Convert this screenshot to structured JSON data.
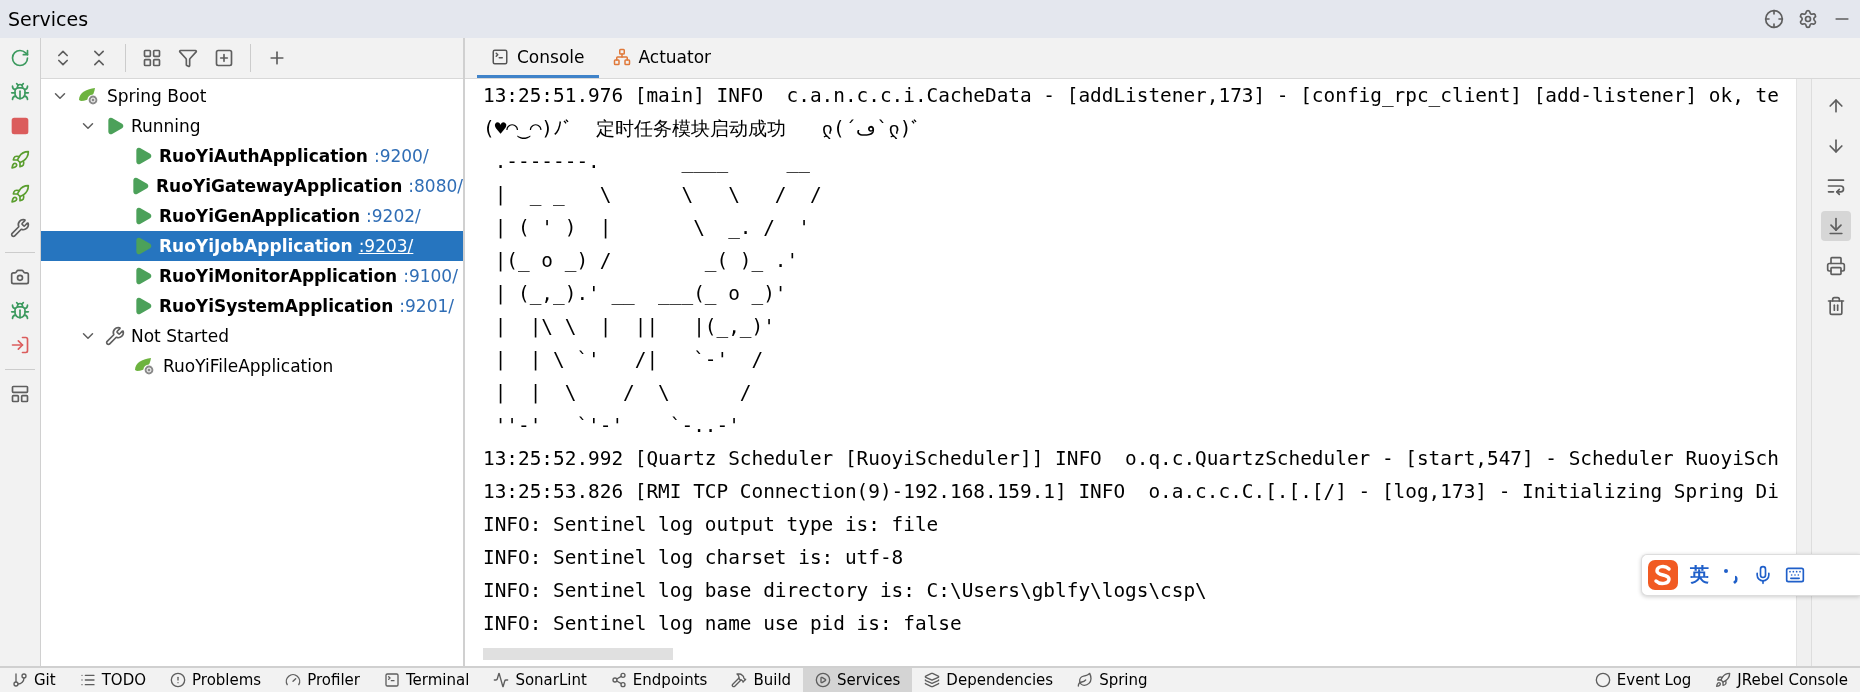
{
  "window": {
    "title": "Services"
  },
  "tree": [
    {
      "label": "Spring Boot",
      "kind": "spring-boot",
      "expanded": true,
      "children": [
        {
          "label": "Running",
          "kind": "running",
          "expanded": true,
          "children": [
            {
              "label": "RuoYiAuthApplication",
              "port": ":9200/",
              "kind": "app",
              "running": true,
              "selected": false
            },
            {
              "label": "RuoYiGatewayApplication",
              "port": ":8080/",
              "kind": "app",
              "running": true,
              "selected": false
            },
            {
              "label": "RuoYiGenApplication",
              "port": ":9202/",
              "kind": "app",
              "running": true,
              "selected": false
            },
            {
              "label": "RuoYiJobApplication",
              "port": ":9203/",
              "kind": "app",
              "running": true,
              "selected": true
            },
            {
              "label": "RuoYiMonitorApplication",
              "port": ":9100/",
              "kind": "app",
              "running": true,
              "selected": false
            },
            {
              "label": "RuoYiSystemApplication",
              "port": ":9201/",
              "kind": "app",
              "running": true,
              "selected": false
            }
          ]
        },
        {
          "label": "Not Started",
          "kind": "not-started",
          "expanded": true,
          "children": [
            {
              "label": "RuoYiFileApplication",
              "kind": "app",
              "running": false,
              "selected": false
            }
          ]
        }
      ]
    }
  ],
  "console": {
    "tabs": [
      {
        "label": "Console",
        "kind": "console",
        "selected": true
      },
      {
        "label": "Actuator",
        "kind": "actuator",
        "selected": false
      }
    ],
    "lines": [
      "13:25:51.976 [main] INFO  c.a.n.c.c.i.CacheData - [addListener,173] - [config_rpc_client] [add-listener] ok, te",
      "(♥◠‿◠)ﾉﾞ  定时任务模块启动成功   ლ(´ڡ`ლ)ﾞ",
      " .-------.       ____     __",
      " |  _ _   \\      \\   \\   /  /",
      " | ( ' )  |       \\  _. /  '",
      " |(_ o _) /        _( )_ .'",
      " | (_,_).' __  ___(_ o _)'",
      " |  |\\ \\  |  ||   |(_,_)'",
      " |  | \\ `'   /|   `-'  /",
      " |  |  \\    /  \\      /",
      " ''-'   `'-'    `-..-'",
      "13:25:52.992 [Quartz Scheduler [RuoyiScheduler]] INFO  o.q.c.QuartzScheduler - [start,547] - Scheduler RuoyiSch",
      "13:25:53.826 [RMI TCP Connection(9)-192.168.159.1] INFO  o.a.c.c.C.[.[.[/] - [log,173] - Initializing Spring Di",
      "INFO: Sentinel log output type is: file",
      "INFO: Sentinel log charset is: utf-8",
      "INFO: Sentinel log base directory is: C:\\Users\\gblfy\\logs\\csp\\",
      "INFO: Sentinel log name use pid is: false"
    ],
    "tools": [
      {
        "kind": "up",
        "on": false
      },
      {
        "kind": "down",
        "on": false
      },
      {
        "kind": "wrap",
        "on": false
      },
      {
        "kind": "scroll-end",
        "on": true
      },
      {
        "kind": "print",
        "on": false
      },
      {
        "kind": "clear",
        "on": false
      }
    ]
  },
  "ime_bar": {
    "mode": "英"
  },
  "bottom_bar": {
    "left": [
      {
        "label": "Git",
        "kind": "git",
        "selected": false
      },
      {
        "label": "TODO",
        "kind": "todo",
        "selected": false
      },
      {
        "label": "Problems",
        "kind": "problems",
        "selected": false
      },
      {
        "label": "Profiler",
        "kind": "profiler",
        "selected": false
      },
      {
        "label": "Terminal",
        "kind": "terminal",
        "selected": false
      },
      {
        "label": "SonarLint",
        "kind": "sonar",
        "selected": false
      },
      {
        "label": "Endpoints",
        "kind": "endpoints",
        "selected": false
      },
      {
        "label": "Build",
        "kind": "build",
        "selected": false
      },
      {
        "label": "Services",
        "kind": "services",
        "selected": true
      },
      {
        "label": "Dependencies",
        "kind": "dependencies",
        "selected": false
      },
      {
        "label": "Spring",
        "kind": "spring",
        "selected": false
      }
    ],
    "right": [
      {
        "label": "Event Log",
        "kind": "event-log",
        "selected": false
      },
      {
        "label": "JRebel Console",
        "kind": "jrebel",
        "selected": false
      }
    ]
  }
}
